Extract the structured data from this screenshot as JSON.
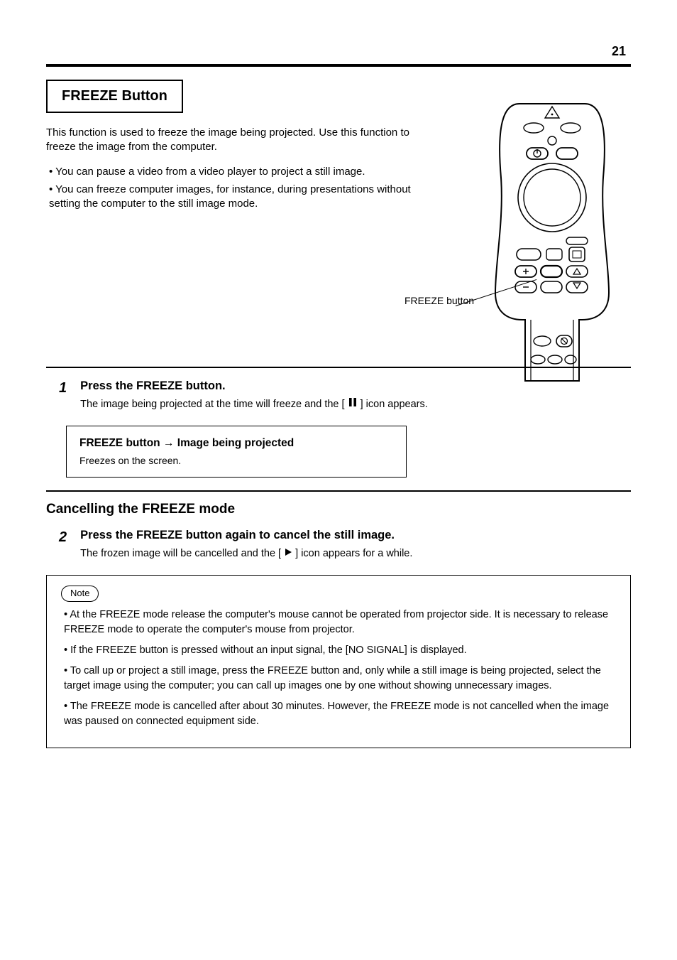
{
  "page_number": "21",
  "section_title": "FREEZE Button",
  "intro": "This function is used to freeze the image being projected. Use this function to freeze the image from the computer.",
  "bullet1": "You can pause a video from a video player to project a still image.",
  "bullet2": "You can freeze computer images, for instance, during presentations without setting the computer to the still image mode.",
  "cancel_heading": "Cancelling the FREEZE mode",
  "step1_main": "Press the FREEZE button.",
  "step1_sub_before": "The image being projected at the time will freeze and the [",
  "step1_sub_after": "] icon appears.",
  "step2_main": "Press the FREEZE button again to cancel the still image.",
  "step2_sub_before": "The frozen image will be cancelled and the [",
  "step2_sub_after": "] icon appears for a while.",
  "freeze_box_line1": "FREEZE button → Image being projected",
  "freeze_box_line2": "Freezes on the screen.",
  "remote_label": "FREEZE button",
  "note_label": "Note",
  "note1": "At the FREEZE mode release the computer's mouse cannot be operated from projector side. It is necessary to release FREEZE mode to operate the computer's mouse from projector.",
  "note2": "If the FREEZE button is pressed without an input signal, the [NO SIGNAL] is displayed.",
  "note3": "To call up or project a still image, press the FREEZE button and, only while a still image is being projected, select the target image using the computer; you can call up images one by one without showing unnecessary images.",
  "note4": "The FREEZE mode is cancelled after about 30 minutes. However, the FREEZE mode is not cancelled when the image was paused on connected equipment side."
}
